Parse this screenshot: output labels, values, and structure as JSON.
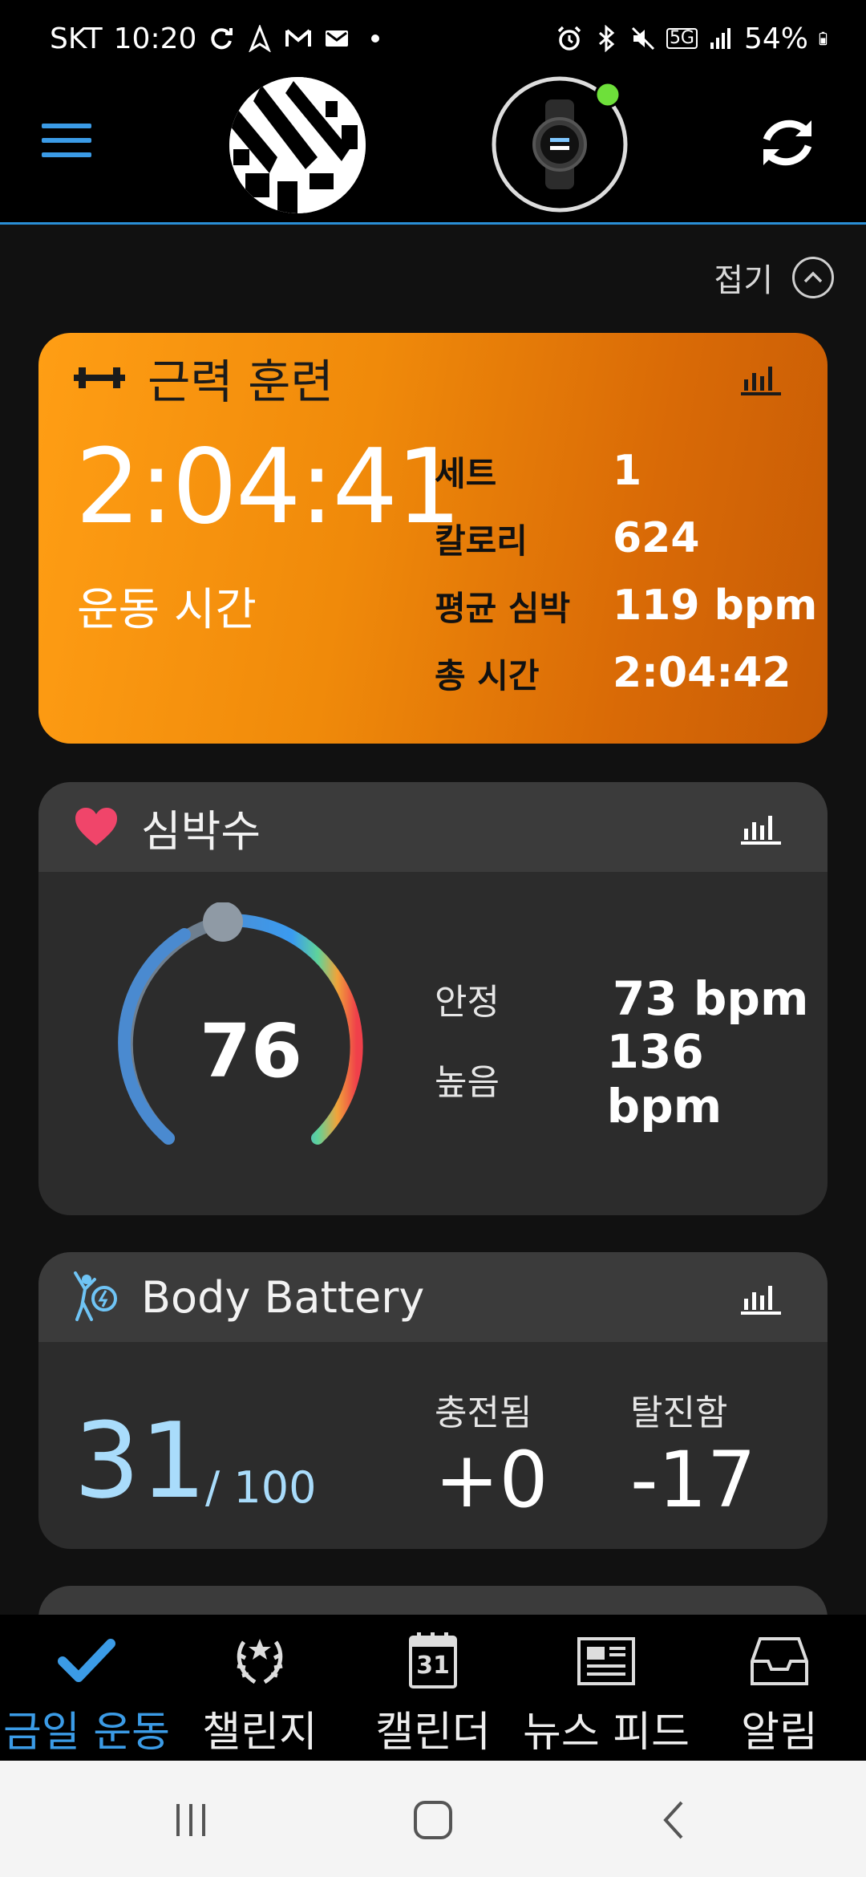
{
  "status_bar": {
    "carrier": "SKT",
    "time": "10:20",
    "network": "5G",
    "battery": "54%"
  },
  "header": {
    "collapse_label": "접기"
  },
  "strength_card": {
    "title": "근력 훈련",
    "duration": "2:04:41",
    "duration_label": "운동 시간",
    "stats": [
      {
        "label": "세트",
        "value": "1"
      },
      {
        "label": "칼로리",
        "value": "624"
      },
      {
        "label": "평균 심박",
        "value": "119 bpm"
      },
      {
        "label": "총 시간",
        "value": "2:04:42"
      }
    ],
    "color": "#f08a0a"
  },
  "heart_card": {
    "title": "심박수",
    "current": "76",
    "stats": [
      {
        "label": "안정",
        "value": "73 bpm"
      },
      {
        "label": "높음",
        "value": "136 bpm"
      }
    ]
  },
  "battery_card": {
    "title": "Body Battery",
    "value": "31",
    "max": "/ 100",
    "charged_label": "충전됨",
    "charged_value": "+0",
    "drained_label": "탈진함",
    "drained_value": "-17",
    "value_color": "#a9dcfb"
  },
  "bottom_nav": {
    "items": [
      {
        "label": "금일 운동",
        "icon": "check-icon"
      },
      {
        "label": "챌린지",
        "icon": "laurel-icon"
      },
      {
        "label": "캘린더",
        "icon": "calendar-icon"
      },
      {
        "label": "뉴스 피드",
        "icon": "newspaper-icon"
      },
      {
        "label": "알림",
        "icon": "inbox-icon"
      }
    ],
    "calendar_day": "31",
    "active_color": "#3b9be6"
  }
}
